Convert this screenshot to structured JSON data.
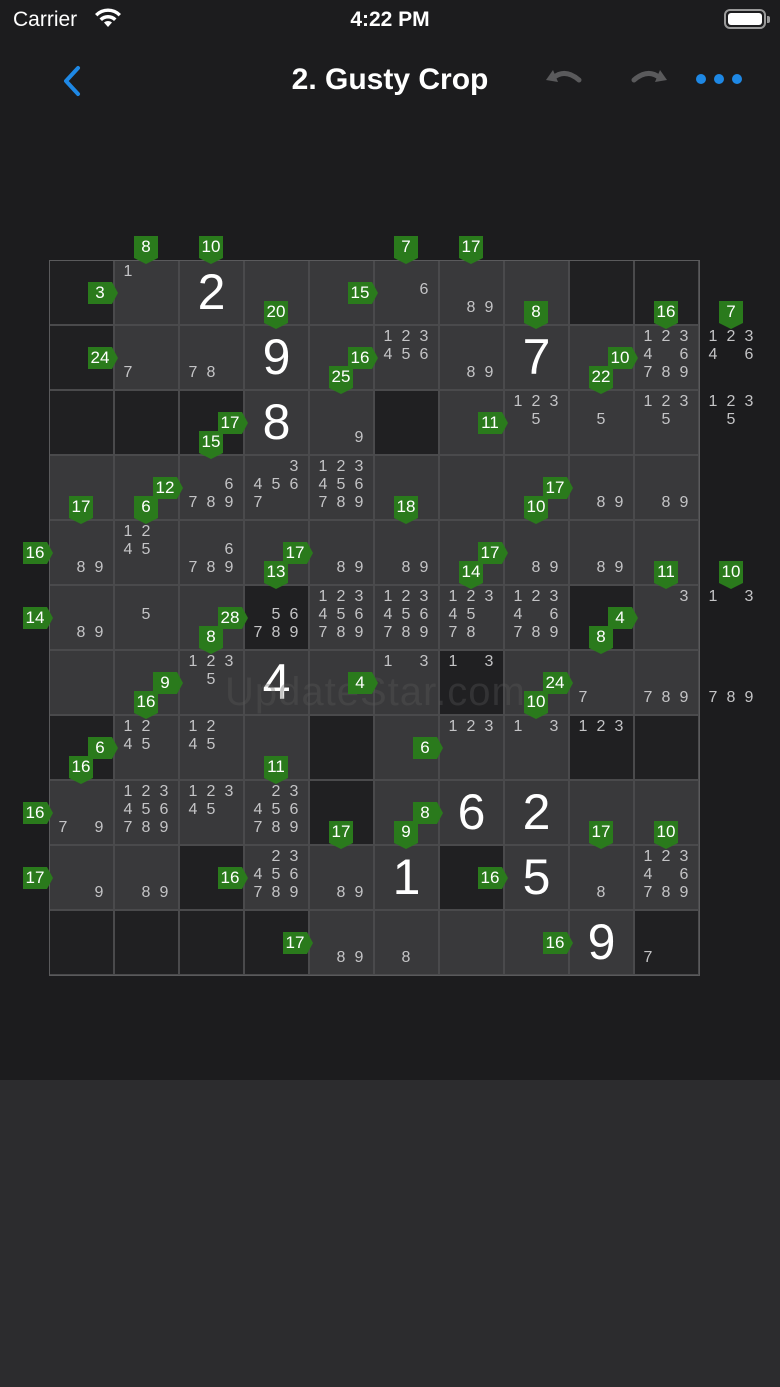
{
  "status": {
    "carrier": "Carrier",
    "time": "4:22 PM"
  },
  "nav": {
    "title": "2. Gusty Crop",
    "back_icon": "chevron-left-icon",
    "undo_icon": "undo-icon",
    "redo_icon": "redo-icon",
    "more_icon": "ellipsis-icon"
  },
  "colors": {
    "accent": "#1e88e5",
    "clue_bg": "#2a7a1c",
    "cell_light": "#39393b",
    "cell_dark": "#202022"
  },
  "watermark": "UpdateStar.com",
  "grid": {
    "light": [
      "0111111100",
      "0111111111",
      "0001101111",
      "1111111111",
      "1111111111",
      "1110111101",
      "1111110111",
      "0111011100",
      "1111011111",
      "1101110111",
      "0000111110"
    ],
    "values": [
      {
        "r": 0,
        "c": 2,
        "v": "2"
      },
      {
        "r": 1,
        "c": 3,
        "v": "9"
      },
      {
        "r": 1,
        "c": 7,
        "v": "7"
      },
      {
        "r": 2,
        "c": 3,
        "v": "8"
      },
      {
        "r": 6,
        "c": 3,
        "v": "4"
      },
      {
        "r": 8,
        "c": 6,
        "v": "6"
      },
      {
        "r": 8,
        "c": 7,
        "v": "2"
      },
      {
        "r": 9,
        "c": 5,
        "v": "1"
      },
      {
        "r": 9,
        "c": 7,
        "v": "5"
      },
      {
        "r": 10,
        "c": 8,
        "v": "9"
      }
    ],
    "notes": [
      {
        "r": 0,
        "c": 1,
        "n": "1"
      },
      {
        "r": 0,
        "c": 5,
        "n": "6"
      },
      {
        "r": 0,
        "c": 6,
        "n": "89"
      },
      {
        "r": 1,
        "c": 1,
        "n": "7"
      },
      {
        "r": 1,
        "c": 2,
        "n": "78"
      },
      {
        "r": 1,
        "c": 5,
        "n": "123456"
      },
      {
        "r": 1,
        "c": 6,
        "n": "89"
      },
      {
        "r": 1,
        "c": 9,
        "n": "12346789"
      },
      {
        "r": 1,
        "c": 10,
        "n": "12346"
      },
      {
        "r": 2,
        "c": 4,
        "n": "9"
      },
      {
        "r": 2,
        "c": 7,
        "n": "1235"
      },
      {
        "r": 2,
        "c": 8,
        "n": "5"
      },
      {
        "r": 2,
        "c": 9,
        "n": "1235"
      },
      {
        "r": 2,
        "c": 10,
        "n": "1235"
      },
      {
        "r": 3,
        "c": 2,
        "n": "6789"
      },
      {
        "r": 3,
        "c": 3,
        "n": "34567"
      },
      {
        "r": 3,
        "c": 4,
        "n": "123456789"
      },
      {
        "r": 3,
        "c": 8,
        "n": "89"
      },
      {
        "r": 3,
        "c": 9,
        "n": "89"
      },
      {
        "r": 4,
        "c": 0,
        "n": "89"
      },
      {
        "r": 4,
        "c": 1,
        "n": "1245"
      },
      {
        "r": 4,
        "c": 2,
        "n": "6789"
      },
      {
        "r": 4,
        "c": 4,
        "n": "89"
      },
      {
        "r": 4,
        "c": 5,
        "n": "89"
      },
      {
        "r": 4,
        "c": 7,
        "n": "89"
      },
      {
        "r": 4,
        "c": 8,
        "n": "89"
      },
      {
        "r": 5,
        "c": 0,
        "n": "89"
      },
      {
        "r": 5,
        "c": 1,
        "n": "5"
      },
      {
        "r": 5,
        "c": 3,
        "n": "56789"
      },
      {
        "r": 5,
        "c": 4,
        "n": "123456789"
      },
      {
        "r": 5,
        "c": 5,
        "n": "123456789"
      },
      {
        "r": 5,
        "c": 6,
        "n": "1234578"
      },
      {
        "r": 5,
        "c": 7,
        "n": "12346789"
      },
      {
        "r": 5,
        "c": 9,
        "n": "3"
      },
      {
        "r": 5,
        "c": 10,
        "n": "13"
      },
      {
        "r": 6,
        "c": 2,
        "n": "1235"
      },
      {
        "r": 6,
        "c": 5,
        "n": "13"
      },
      {
        "r": 6,
        "c": 6,
        "n": "13"
      },
      {
        "r": 6,
        "c": 8,
        "n": "7"
      },
      {
        "r": 6,
        "c": 9,
        "n": "789"
      },
      {
        "r": 6,
        "c": 10,
        "n": "789"
      },
      {
        "r": 7,
        "c": 1,
        "n": "1245"
      },
      {
        "r": 7,
        "c": 2,
        "n": "1245"
      },
      {
        "r": 7,
        "c": 6,
        "n": "123"
      },
      {
        "r": 7,
        "c": 7,
        "n": "13"
      },
      {
        "r": 7,
        "c": 8,
        "n": "123"
      },
      {
        "r": 8,
        "c": 0,
        "n": "79"
      },
      {
        "r": 8,
        "c": 1,
        "n": "123456789"
      },
      {
        "r": 8,
        "c": 2,
        "n": "12345"
      },
      {
        "r": 8,
        "c": 3,
        "n": "23456789"
      },
      {
        "r": 9,
        "c": 0,
        "n": "9"
      },
      {
        "r": 9,
        "c": 1,
        "n": "89"
      },
      {
        "r": 9,
        "c": 3,
        "n": "23456789"
      },
      {
        "r": 9,
        "c": 4,
        "n": "89"
      },
      {
        "r": 9,
        "c": 8,
        "n": "8"
      },
      {
        "r": 9,
        "c": 9,
        "n": "12346789"
      },
      {
        "r": 10,
        "c": 4,
        "n": "89"
      },
      {
        "r": 10,
        "c": 5,
        "n": "8"
      },
      {
        "r": 10,
        "c": 9,
        "n": "7"
      }
    ],
    "clues": [
      {
        "r": -1,
        "c": 1,
        "v": "8",
        "d": "down"
      },
      {
        "r": -1,
        "c": 2,
        "v": "10",
        "d": "down"
      },
      {
        "r": -1,
        "c": 5,
        "v": "7",
        "d": "down"
      },
      {
        "r": -1,
        "c": 6,
        "v": "17",
        "d": "down"
      },
      {
        "r": 0,
        "c": 0,
        "v": "3",
        "d": "right"
      },
      {
        "r": 0,
        "c": 3,
        "v": "20",
        "d": "down"
      },
      {
        "r": 0,
        "c": 4,
        "v": "15",
        "d": "right"
      },
      {
        "r": 0,
        "c": 7,
        "v": "8",
        "d": "down"
      },
      {
        "r": 0,
        "c": 9,
        "v": "16",
        "d": "down"
      },
      {
        "r": 0,
        "c": 10,
        "v": "7",
        "d": "down"
      },
      {
        "r": 1,
        "c": 0,
        "v": "24",
        "d": "right"
      },
      {
        "r": 1,
        "c": 4,
        "v": "16",
        "d": "right"
      },
      {
        "r": 1,
        "c": 4,
        "v": "25",
        "d": "down"
      },
      {
        "r": 1,
        "c": 8,
        "v": "10",
        "d": "right"
      },
      {
        "r": 1,
        "c": 8,
        "v": "22",
        "d": "down"
      },
      {
        "r": 2,
        "c": 2,
        "v": "17",
        "d": "right"
      },
      {
        "r": 2,
        "c": 2,
        "v": "15",
        "d": "down"
      },
      {
        "r": 2,
        "c": 6,
        "v": "11",
        "d": "right"
      },
      {
        "r": 3,
        "c": 0,
        "v": "17",
        "d": "down"
      },
      {
        "r": 3,
        "c": 1,
        "v": "12",
        "d": "right"
      },
      {
        "r": 3,
        "c": 1,
        "v": "6",
        "d": "down"
      },
      {
        "r": 3,
        "c": 5,
        "v": "18",
        "d": "down"
      },
      {
        "r": 3,
        "c": 7,
        "v": "17",
        "d": "right"
      },
      {
        "r": 3,
        "c": 7,
        "v": "10",
        "d": "down"
      },
      {
        "r": 4,
        "c": -1,
        "v": "16",
        "d": "right"
      },
      {
        "r": 4,
        "c": 3,
        "v": "17",
        "d": "right"
      },
      {
        "r": 4,
        "c": 3,
        "v": "13",
        "d": "down"
      },
      {
        "r": 4,
        "c": 6,
        "v": "17",
        "d": "right"
      },
      {
        "r": 4,
        "c": 6,
        "v": "14",
        "d": "down"
      },
      {
        "r": 4,
        "c": 9,
        "v": "11",
        "d": "down"
      },
      {
        "r": 4,
        "c": 10,
        "v": "10",
        "d": "down"
      },
      {
        "r": 5,
        "c": -1,
        "v": "14",
        "d": "right"
      },
      {
        "r": 5,
        "c": 2,
        "v": "28",
        "d": "right"
      },
      {
        "r": 5,
        "c": 2,
        "v": "8",
        "d": "down"
      },
      {
        "r": 5,
        "c": 8,
        "v": "4",
        "d": "right"
      },
      {
        "r": 5,
        "c": 8,
        "v": "8",
        "d": "down"
      },
      {
        "r": 6,
        "c": 1,
        "v": "9",
        "d": "right"
      },
      {
        "r": 6,
        "c": 1,
        "v": "16",
        "d": "down"
      },
      {
        "r": 6,
        "c": 4,
        "v": "4",
        "d": "right"
      },
      {
        "r": 6,
        "c": 7,
        "v": "24",
        "d": "right"
      },
      {
        "r": 6,
        "c": 7,
        "v": "10",
        "d": "down"
      },
      {
        "r": 7,
        "c": 0,
        "v": "6",
        "d": "right"
      },
      {
        "r": 7,
        "c": 0,
        "v": "16",
        "d": "down"
      },
      {
        "r": 7,
        "c": 3,
        "v": "11",
        "d": "down"
      },
      {
        "r": 7,
        "c": 5,
        "v": "6",
        "d": "right"
      },
      {
        "r": 8,
        "c": -1,
        "v": "16",
        "d": "right"
      },
      {
        "r": 8,
        "c": 4,
        "v": "17",
        "d": "down"
      },
      {
        "r": 8,
        "c": 5,
        "v": "8",
        "d": "right"
      },
      {
        "r": 8,
        "c": 5,
        "v": "9",
        "d": "down"
      },
      {
        "r": 8,
        "c": 8,
        "v": "17",
        "d": "down"
      },
      {
        "r": 8,
        "c": 9,
        "v": "10",
        "d": "down"
      },
      {
        "r": 9,
        "c": -1,
        "v": "17",
        "d": "right"
      },
      {
        "r": 9,
        "c": 2,
        "v": "16",
        "d": "right"
      },
      {
        "r": 9,
        "c": 6,
        "v": "16",
        "d": "right"
      },
      {
        "r": 10,
        "c": 3,
        "v": "17",
        "d": "right"
      },
      {
        "r": 10,
        "c": 7,
        "v": "16",
        "d": "right"
      }
    ]
  }
}
